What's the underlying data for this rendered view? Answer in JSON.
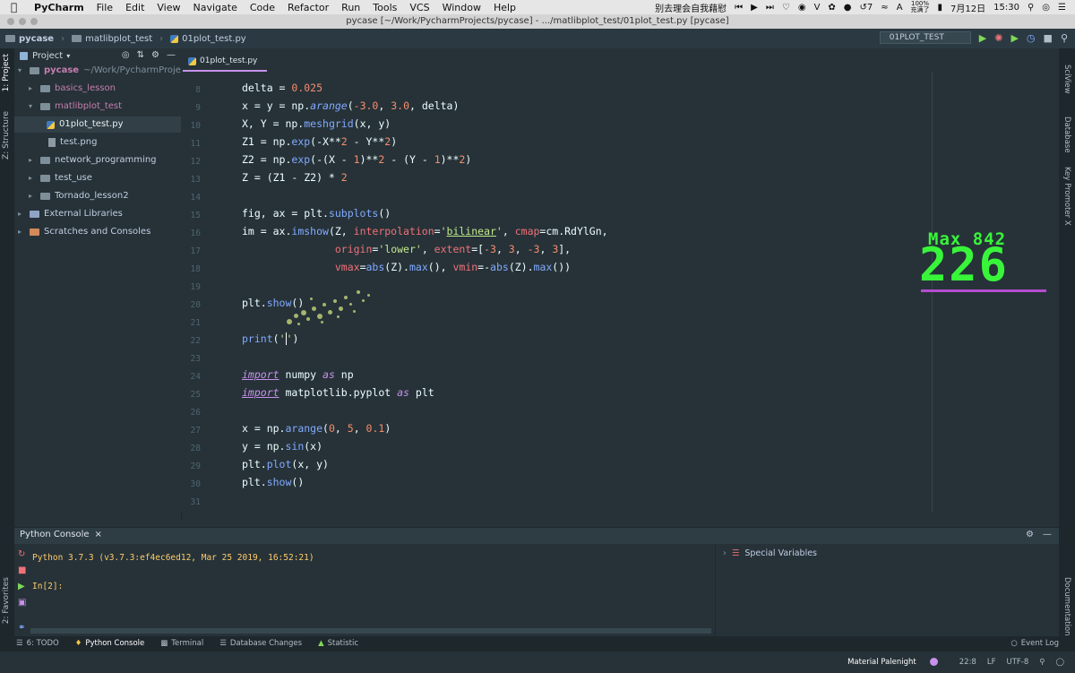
{
  "menubar": {
    "app": "PyCharm",
    "items": [
      "File",
      "Edit",
      "View",
      "Navigate",
      "Code",
      "Refactor",
      "Run",
      "Tools",
      "VCS",
      "Window",
      "Help"
    ],
    "song": "别去理会自我藉慰",
    "battery_count": "7",
    "battery": "100%",
    "battery_label": "充满了",
    "date": "7月12日",
    "time": "15:30"
  },
  "window": {
    "title": "pycase [~/Work/PycharmProjects/pycase] - .../matlibplot_test/01plot_test.py [pycase]"
  },
  "navbar": {
    "crumbs": [
      "pycase",
      "matlibplot_test",
      "01plot_test.py"
    ],
    "run_config": "01PLOT_TEST"
  },
  "left_strip": {
    "project": "1: Project",
    "structure": "Z: Structure",
    "favorites": "2: Favorites"
  },
  "project": {
    "header": "Project",
    "root": "pycase",
    "root_path": "~/Work/PycharmProjects/py",
    "items": [
      {
        "label": "basics_lesson"
      },
      {
        "label": "matlibplot_test"
      },
      {
        "label": "01plot_test.py"
      },
      {
        "label": "test.png"
      },
      {
        "label": "network_programming"
      },
      {
        "label": "test_use"
      },
      {
        "label": "Tornado_lesson2"
      },
      {
        "label": "External Libraries"
      },
      {
        "label": "Scratches and Consoles"
      }
    ]
  },
  "editor": {
    "tab": "01plot_test.py",
    "line_numbers": [
      "8",
      "9",
      "10",
      "11",
      "12",
      "13",
      "14",
      "15",
      "16",
      "17",
      "18",
      "19",
      "20",
      "21",
      "22",
      "23",
      "24",
      "25",
      "26",
      "27",
      "28",
      "29",
      "30",
      "31"
    ]
  },
  "right_strip": {
    "sciview": "SciView",
    "database": "Database",
    "key_promoter": "Key Promoter X",
    "documentation": "Documentation"
  },
  "overlay": {
    "max_label": "Max 842",
    "count": "226"
  },
  "console": {
    "tab": "Python Console",
    "version": "Python 3.7.3 (v3.7.3:ef4ec6ed12, Mar 25 2019, 16:52:21)",
    "prompt": "In[2]:",
    "special_variables": "Special Variables"
  },
  "toolwindows": {
    "todo": "6: TODO",
    "python_console": "Python Console",
    "terminal": "Terminal",
    "db_changes": "Database Changes",
    "statistic": "Statistic",
    "event_log": "Event Log"
  },
  "status": {
    "theme": "Material Palenight",
    "position": "22:8",
    "line_sep": "LF",
    "encoding": "UTF-8"
  },
  "colors": {
    "background": "#263238",
    "keyword": "#c792ea",
    "function": "#82aaff",
    "string": "#c3e88d",
    "number": "#f78c6c",
    "overlay_green": "#38f53a",
    "overlay_bar": "#b44cd0"
  }
}
